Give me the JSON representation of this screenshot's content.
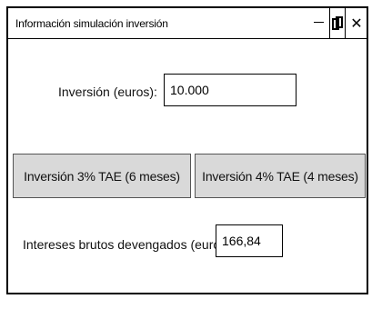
{
  "window": {
    "title": "Información simulación inversión",
    "minimize_icon": "minimize-icon",
    "link_icon": "link-icon",
    "close_icon": "close-icon",
    "close_glyph": "✕"
  },
  "form": {
    "investment_label": "Inversión (euros):",
    "investment_value": "10.000",
    "button_3": "Inversión 3% TAE (6 meses)",
    "button_4": "Inversión 4% TAE (4 meses)",
    "interest_label": "Intereses brutos devengados (euros):",
    "interest_value": "166,84"
  }
}
